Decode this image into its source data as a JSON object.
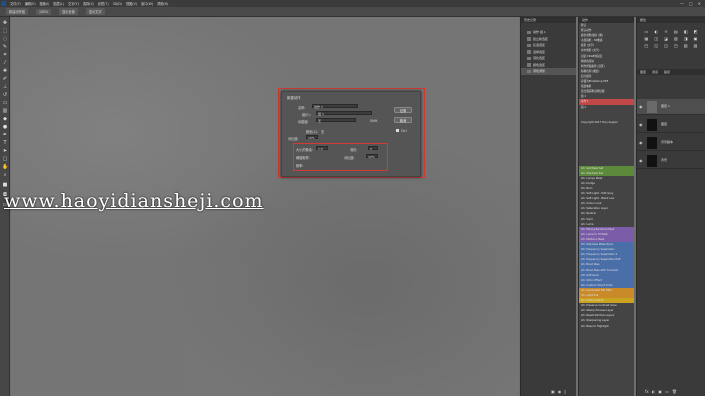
{
  "menubar": {
    "items": [
      "文件(F)",
      "编辑(E)",
      "图像(I)",
      "图层(L)",
      "文字(Y)",
      "选择(S)",
      "滤镜(T)",
      "3D(D)",
      "视图(V)",
      "窗口(W)",
      "帮助(H)"
    ],
    "controls": [
      "—",
      "□",
      "✕"
    ]
  },
  "optionsbar": {
    "items": [
      "新建动作组",
      "100%",
      "显示全部",
      "显示文字"
    ]
  },
  "watermark": "www.haoyidiansheji.com",
  "dialog": {
    "title": "新建动作",
    "name_label": "名称:",
    "name_value": "动作 1",
    "set_label": "组(E):",
    "set_value": "组 1",
    "fkey_label": "功能键:",
    "fkey_value": "无",
    "shift_label": "Shift",
    "color_label": "颜色(C):",
    "color_value": "无",
    "ok_label": "记录",
    "cancel_label": "取消",
    "check_label": "Ctrl",
    "row1_label": "大小的像素:",
    "row1_value": "1.0",
    "row2_label": "羽化:",
    "row2_value": "0",
    "row3_label": "阈值取样:",
    "row3_value": "0",
    "row4_label": "对比度:",
    "row4_value": "10%",
    "row5_label": "频率:"
  },
  "actions_panel": {
    "header": "历史记录",
    "rows": [
      "动作 组 1",
      "建立新选区",
      "反选选区",
      "选择选区",
      "羽化选区",
      "颜色选区",
      "调色调整"
    ],
    "selected_index": 6
  },
  "list_panel": {
    "header": "动作",
    "items": [
      "默认",
      "默认动作",
      "颜色调整/胶片 (图)",
      "木质画框 - 50像素",
      "投影 (文字)",
      "水中倒影 (文字)",
      "自定义RGB到灰度",
      "熔化的铅块",
      "制作剪贴路径 (选区)",
      "棕褐色调 (图层)",
      "四分颜色",
      "存储为Photoshop PDF",
      "渐变映射",
      "混合器画笔克隆绘图",
      "组 1",
      "动作 1",
      "组 2",
      "",
      "",
      "Copyright 2017 Tony Kuyper",
      "",
      "",
      "",
      "",
      "",
      "",
      "",
      "",
      "Gh: Sat Mask Sat",
      "Gh: Shadows Sat",
      "Gh: Lumps Mask",
      "Gh: Dodge",
      "Gh: Burn",
      "Gh: Soft Light - Edit Grey",
      "Gh: Soft Light - Black Low",
      "Gh: Colour Lock",
      "Gh: Saturation Layer",
      "Gh: Neutral",
      "Gh: Vivid",
      "Gh: Luma",
      "Gh: Mixing Rainbow Mask",
      "Gh: Luma to HI Mask",
      "Gh: Midtone Mask",
      "Gh: Shadows Mask Zone",
      "Gh: Frequency Separation",
      "Gh: Frequency Separation 2",
      "Gh: Frequency Separation Edit",
      "Gh: Band Pass",
      "Gh: Band Pass with Contrast",
      "Gh: Soft Glow",
      "Gh: Orton Effect",
      "Gh: Custom Smart Orton",
      "Gh: Graduated ND Filter",
      "Gh: Light Pull",
      "Gh: Colour Grade",
      "Gh: Preserve Contrast Save",
      "Gh: Stamp Process Layer",
      "Gh: Reset Sat Plus Layers",
      "Gh: Sharpening Layer",
      "Gh: Base to Highlight"
    ],
    "highlights": {
      "15": "#c24848",
      "28": "#5d8a3a",
      "29": "#5d8a3a",
      "40": "#7a5ca8",
      "41": "#7a5ca8",
      "42": "#7a5ca8",
      "43": "#4a6ea8",
      "44": "#4a6ea8",
      "45": "#4a6ea8",
      "46": "#4a6ea8",
      "47": "#4a6ea8",
      "48": "#4a6ea8",
      "49": "#4a6ea8",
      "50": "#4a6ea8",
      "51": "#4a6ea8",
      "52": "#c98a2a",
      "53": "#c98a2a",
      "54": "#c9a320"
    }
  },
  "right_panel": {
    "header": "属性",
    "grid_icons": [
      "▭",
      "◐",
      "☼",
      "▤",
      "◧",
      "◩",
      "▦",
      "◫",
      "◪",
      "▥",
      "◨",
      "▣",
      "◰",
      "◱",
      "◲",
      "◳",
      "▧",
      "▨"
    ],
    "layer_tabs": [
      "图层",
      "通道",
      "路径"
    ],
    "layers": [
      {
        "name": "图层 1",
        "selected": true
      },
      {
        "name": "图层",
        "selected": false
      },
      {
        "name": "背景副本",
        "selected": false
      },
      {
        "name": "背景",
        "selected": false
      }
    ],
    "bottom_icons": [
      "fx",
      "◐",
      "▣",
      "▭",
      "🗑"
    ]
  },
  "colors": {
    "highlight_red": "#d23a32",
    "panel_bg": "#3a3a3a",
    "canvas_bg": "#757575"
  }
}
